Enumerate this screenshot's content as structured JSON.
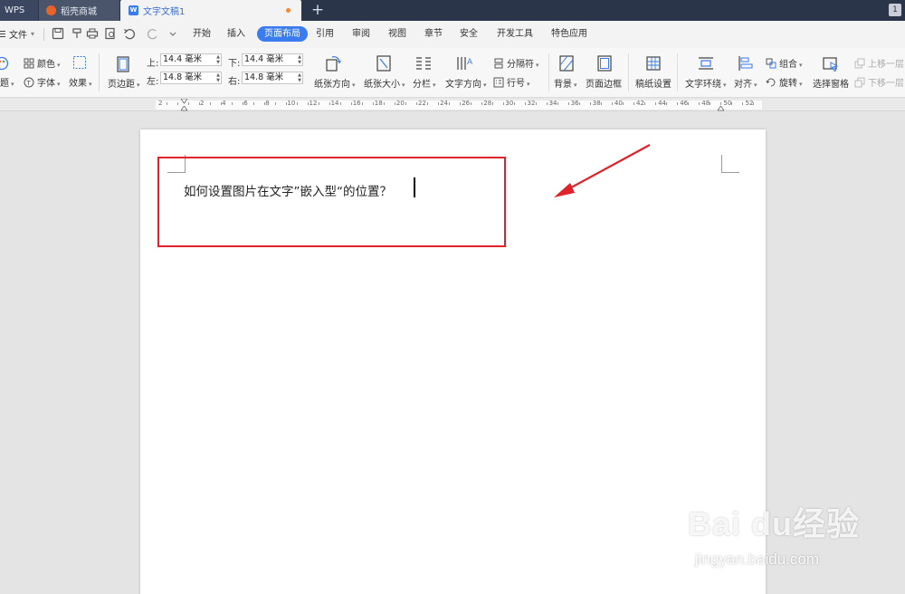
{
  "tabs": [
    {
      "label": "WPS"
    },
    {
      "label": "稻壳商城"
    },
    {
      "label": "文字文稿1"
    }
  ],
  "window_badge": "1",
  "menu": {
    "file": "文件",
    "tabs": [
      "开始",
      "插入",
      "页面布局",
      "引用",
      "审阅",
      "视图",
      "章节",
      "安全",
      "开发工具",
      "特色应用"
    ],
    "active": "页面布局"
  },
  "ribbon": {
    "color": "颜色",
    "theme": "题",
    "font": "字体",
    "effect": "效果",
    "margins": "页边距",
    "top_label": "上:",
    "bottom_label": "下:",
    "left_label": "左:",
    "right_label": "右:",
    "top_value": "14.4 毫米",
    "bottom_value": "14.4 毫米",
    "left_value": "14.8 毫米",
    "right_value": "14.8 毫米",
    "orientation": "纸张方向",
    "size": "纸张大小",
    "columns": "分栏",
    "text_direction": "文字方向",
    "breaks": "分隔符",
    "line_numbers": "行号",
    "background": "背景",
    "page_border": "页面边框",
    "paper_setup": "稿纸设置",
    "wrap_text": "文字环绕",
    "align": "对齐",
    "group": "组合",
    "rotate": "旋转",
    "selection_pane": "选择窗格",
    "bring_forward": "上移一层",
    "send_backward": "下移一层"
  },
  "ruler": {
    "numbers": [
      "2",
      "2",
      "4",
      "6",
      "8",
      "10",
      "12",
      "14",
      "16",
      "18",
      "20",
      "22",
      "24",
      "26",
      "28",
      "30",
      "32",
      "34",
      "36",
      "38",
      "40",
      "42",
      "44",
      "46",
      "48",
      "50",
      "52"
    ]
  },
  "document": {
    "text": "如何设置图片在文字”嵌入型“的位置？"
  },
  "colors": {
    "accent": "#3a7cf0",
    "annotation_red": "#e0222a",
    "titlebar": "#2b3549"
  },
  "watermark": {
    "brand": "Bai du经验",
    "site": "jingyan.baidu.com"
  }
}
